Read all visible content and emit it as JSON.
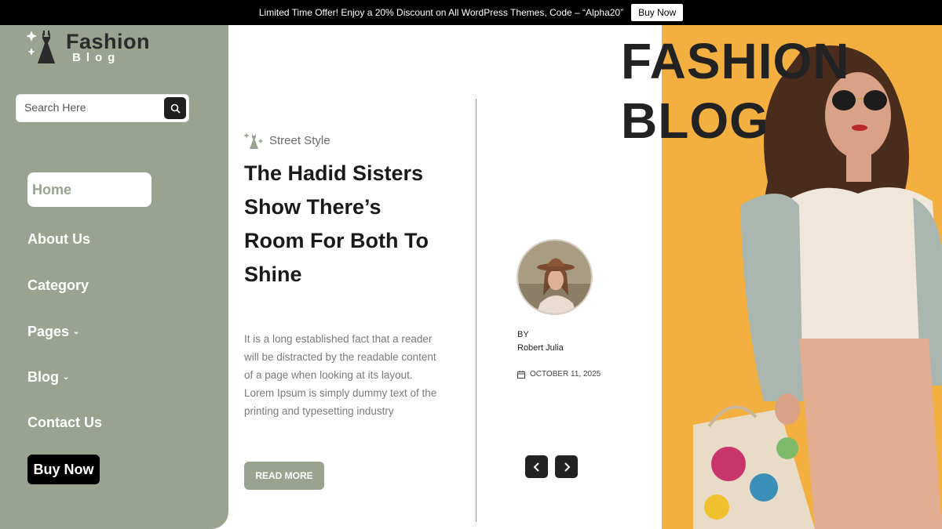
{
  "topbar": {
    "text": "Limited Time Offer! Enjoy a 20% Discount on All WordPress Themes, Code – “Alpha20”",
    "button": "Buy Now"
  },
  "logo": {
    "title": "Fashion",
    "subtitle": "Blog"
  },
  "search": {
    "placeholder": "Search Here",
    "value": ""
  },
  "nav": {
    "items": [
      {
        "label": "Home",
        "active": true
      },
      {
        "label": "About Us"
      },
      {
        "label": "Category"
      },
      {
        "label": "Pages",
        "dropdown": true
      },
      {
        "label": "Blog",
        "dropdown": true
      },
      {
        "label": "Contact Us"
      }
    ],
    "buy_now": "Buy Now"
  },
  "post": {
    "category": "Street Style",
    "title": "The Hadid Sisters Show There’s Room For Both To Shine",
    "excerpt": "It is a long established fact that a reader will be distracted by the readable content of a page when looking at its layout. Lorem Ipsum is simply dummy text of the printing and typesetting industry",
    "read_more": "READ MORE",
    "by_label": "BY",
    "author": "Robert Julia",
    "date": "OCTOBER 11, 2025"
  },
  "hero": {
    "line1": "FASHION",
    "line2": "BLOG"
  },
  "colors": {
    "sidebar": "#99a38f",
    "accent": "#f3b041",
    "dark": "#1a1a1a"
  }
}
